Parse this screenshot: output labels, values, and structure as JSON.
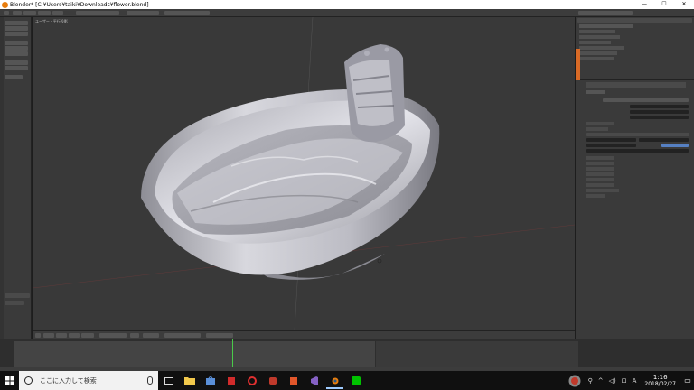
{
  "window": {
    "title": "Blender* [C:¥Users¥taiki¥Downloads¥flower.blend]",
    "minimize": "—",
    "maximize": "☐",
    "close": "✕"
  },
  "viewport": {
    "label": "ユーザー・平行投影"
  },
  "taskbar": {
    "search_placeholder": "ここに入力して検索",
    "time": "1:16",
    "date": "2018/02/27",
    "ime": "A"
  },
  "icons": {
    "start": "windows-logo-icon",
    "task_view": "task-view-icon",
    "explorer": "folder-icon",
    "store": "store-icon",
    "app1": "red-app-icon",
    "app2": "red-app-icon-2",
    "app3": "red-app-icon-3",
    "office": "office-icon",
    "vs": "visual-studio-icon",
    "blender": "blender-icon",
    "line": "line-icon"
  },
  "colors": {
    "accent_orange": "#d96a26",
    "timeline_cursor": "#4aca4a",
    "selected_blue": "#5680c2"
  }
}
